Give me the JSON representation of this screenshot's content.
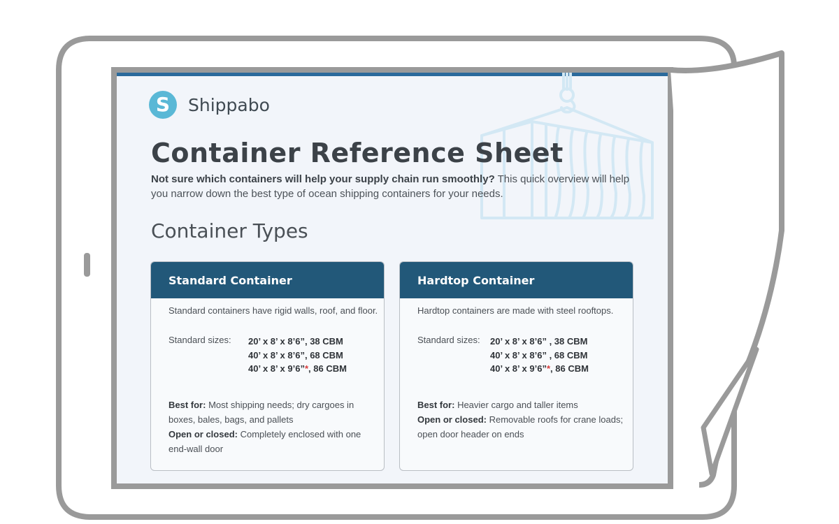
{
  "brand": {
    "name": "Shippabo",
    "logo_letter": "S"
  },
  "page": {
    "title": "Container Reference Sheet",
    "intro_bold": "Not sure which containers will help your supply chain run smoothly?",
    "intro_rest": " This quick overview will help you narrow down the best type of ocean shipping containers for your needs.",
    "section_title": "Container Types"
  },
  "cards": [
    {
      "title": "Standard Container",
      "description": "Standard containers have rigid walls, roof, and floor.",
      "sizes_label": "Standard sizes:",
      "sizes": [
        {
          "dims": "20’ x 8’ x 8’6”",
          "star": "",
          "rest": ", 38 CBM"
        },
        {
          "dims": "40’ x 8’ x 8’6”",
          "star": "",
          "rest": ", 68 CBM"
        },
        {
          "dims": "40’ x 8’ x 9’6”",
          "star": "*",
          "rest": ", 86 CBM"
        }
      ],
      "best_for_label": "Best for:",
      "best_for": " Most shipping needs; dry cargoes in boxes, bales, bags, and pallets",
      "open_closed_label": "Open or closed:",
      "open_closed": " Completely enclosed with one end-wall door"
    },
    {
      "title": "Hardtop Container",
      "description": "Hardtop containers are made with steel rooftops.",
      "sizes_label": "Standard sizes:",
      "sizes": [
        {
          "dims": "20’ x 8’ x 8’6”",
          "star": "",
          "rest": " , 38 CBM"
        },
        {
          "dims": "40’ x 8’ x 8’6”",
          "star": "",
          "rest": " , 68 CBM"
        },
        {
          "dims": "40’ x 8’ x 9’6”",
          "star": "*",
          "rest": ", 86 CBM"
        }
      ],
      "best_for_label": "Best for:",
      "best_for": " Heavier cargo and taller items",
      "open_closed_label": "Open or closed:",
      "open_closed": " Removable roofs for crane loads; open door header on ends"
    }
  ],
  "colors": {
    "accent_bar": "#2b6a9c",
    "card_header": "#225879",
    "logo": "#5ab8d6",
    "asterisk": "#d93a3a",
    "illustration": "#d3e8f4"
  },
  "icons": {
    "logo": "shippabo-logo-icon",
    "illustration": "container-crane-illustration",
    "device_button": "tablet-side-button"
  }
}
